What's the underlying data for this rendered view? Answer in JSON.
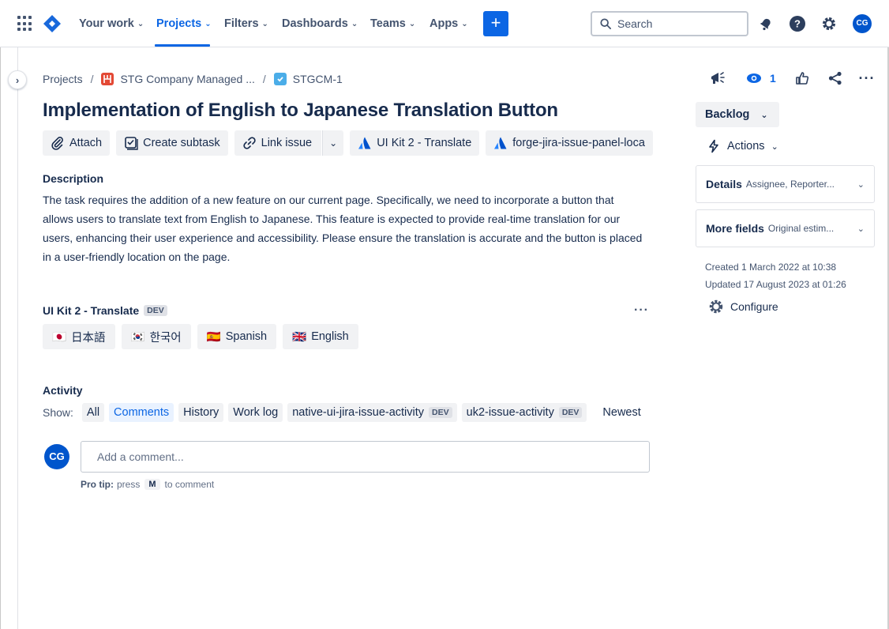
{
  "nav": {
    "items": [
      {
        "label": "Your work",
        "active": false
      },
      {
        "label": "Projects",
        "active": true
      },
      {
        "label": "Filters",
        "active": false
      },
      {
        "label": "Dashboards",
        "active": false
      },
      {
        "label": "Teams",
        "active": false
      },
      {
        "label": "Apps",
        "active": false
      }
    ],
    "create_label": "+",
    "search_placeholder": "Search",
    "user_initials": "CG"
  },
  "breadcrumb": {
    "root": "Projects",
    "project": "STG Company Managed ...",
    "issue_key": "STGCM-1"
  },
  "issue": {
    "title": "Implementation of English to Japanese Translation Button"
  },
  "toolbar": {
    "attach": "Attach",
    "create_subtask": "Create subtask",
    "link_issue": "Link issue",
    "uikit_translate": "UI Kit 2 - Translate",
    "forge_panel": "forge-jira-issue-panel-loca"
  },
  "description": {
    "heading": "Description",
    "text": "The task requires the addition of a new feature on our current page. Specifically, we need to incorporate a button that allows users to translate text from English to Japanese. This feature is expected to provide real-time translation for our users, enhancing their user experience and accessibility. Please ensure the translation is accurate and the button is placed in a user-friendly location on the page."
  },
  "uikit_panel": {
    "title": "UI Kit 2 - Translate",
    "badge": "DEV",
    "languages": [
      {
        "flag": "🇯🇵",
        "label": "日本語"
      },
      {
        "flag": "🇰🇷",
        "label": "한국어"
      },
      {
        "flag": "🇪🇸",
        "label": "Spanish"
      },
      {
        "flag": "🇬🇧",
        "label": "English"
      }
    ]
  },
  "activity": {
    "heading": "Activity",
    "show_label": "Show:",
    "filters": {
      "all": "All",
      "comments": "Comments",
      "history": "History",
      "work_log": "Work log",
      "native": "native-ui-jira-issue-activity",
      "native_badge": "DEV",
      "uk2": "uk2-issue-activity",
      "uk2_badge": "DEV",
      "sort": "Newest"
    },
    "comment_placeholder": "Add a comment...",
    "avatar_initials": "CG",
    "protip": {
      "prefix": "Pro tip:",
      "press": "press",
      "key": "M",
      "suffix": "to comment"
    }
  },
  "right": {
    "watchers": "1",
    "status": "Backlog",
    "actions": "Actions",
    "details": {
      "label": "Details",
      "sub": "Assignee, Reporter..."
    },
    "more_fields": {
      "label": "More fields",
      "sub": "Original estim..."
    },
    "created": "Created 1 March 2022 at 10:38",
    "updated": "Updated 17 August 2023 at 01:26",
    "configure": "Configure"
  },
  "colors": {
    "brand": "#0c66e4",
    "avatar": "#0055cc",
    "text": "#172b4d",
    "subtle": "#44546f",
    "button_bg": "#f1f2f4"
  }
}
